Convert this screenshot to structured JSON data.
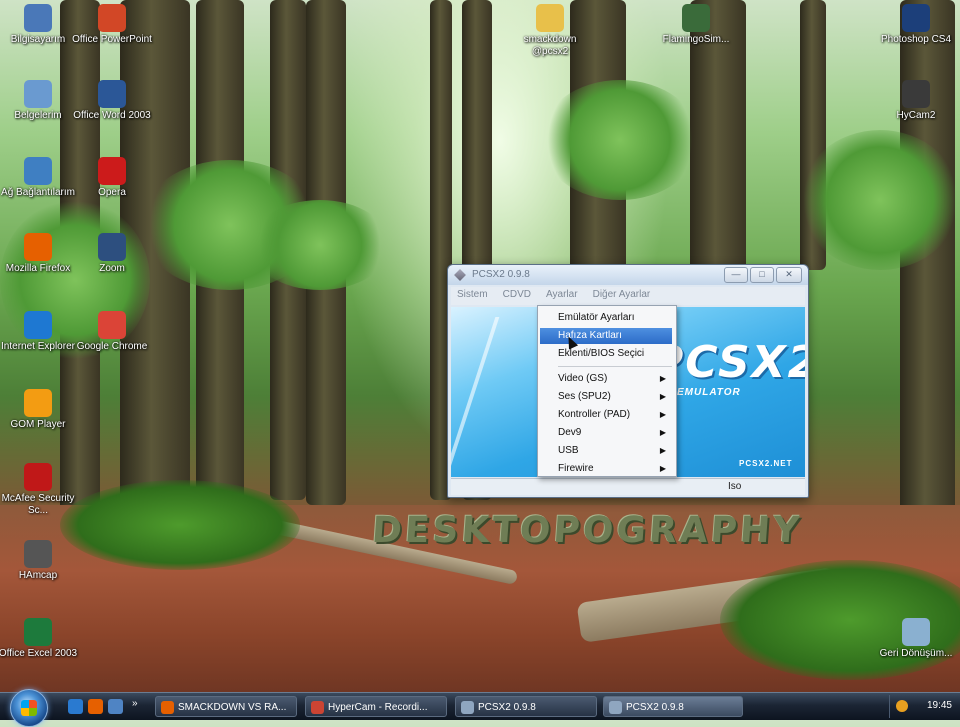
{
  "watermark": "DESKTOPOGRAPHY",
  "desktop_icons": [
    {
      "label": "Bilgisayarım",
      "icon": "computer-icon",
      "color": "#4a78b8"
    },
    {
      "label": "Office PowerPoint",
      "icon": "powerpoint-icon",
      "color": "#d24726"
    },
    {
      "label": "smackdown @pcsx2",
      "icon": "folder-icon",
      "color": "#e8c04a"
    },
    {
      "label": "FlamingoSim...",
      "icon": "game-icon",
      "color": "#3a6b3a"
    },
    {
      "label": "Photoshop CS4",
      "icon": "photoshop-icon",
      "color": "#1c3f7a"
    },
    {
      "label": "Belgelerim",
      "icon": "documents-icon",
      "color": "#6a9ad0"
    },
    {
      "label": "Office Word 2003",
      "icon": "word-icon",
      "color": "#2b5797"
    },
    {
      "label": "HyCam2",
      "icon": "camera-icon",
      "color": "#3a3a3a"
    },
    {
      "label": "Ağ Bağlantılarım",
      "icon": "network-icon",
      "color": "#3f7fc2"
    },
    {
      "label": "Opera",
      "icon": "opera-icon",
      "color": "#cc1b1b"
    },
    {
      "label": "Mozilla Firefox",
      "icon": "firefox-icon",
      "color": "#e66000"
    },
    {
      "label": "Zoom",
      "icon": "binoculars-icon",
      "color": "#2d4f7f"
    },
    {
      "label": "Internet Explorer",
      "icon": "ie-icon",
      "color": "#1e78d2"
    },
    {
      "label": "Google Chrome",
      "icon": "chrome-icon",
      "color": "#db4437"
    },
    {
      "label": "GOM Player",
      "icon": "gom-icon",
      "color": "#f39c12"
    },
    {
      "label": "McAfee Security Sc...",
      "icon": "mcafee-icon",
      "color": "#c01818"
    },
    {
      "label": "HAmcap",
      "icon": "hamcap-icon",
      "color": "#555555"
    },
    {
      "label": "Office Excel 2003",
      "icon": "excel-icon",
      "color": "#1d7a3c"
    },
    {
      "label": "Geri Dönüşüm...",
      "icon": "recycle-bin-icon",
      "color": "#8ab0d0"
    }
  ],
  "window": {
    "title": "PCSX2  0.9.8",
    "menu": [
      "Sistem",
      "CDVD",
      "Ayarlar",
      "Diğer Ayarlar"
    ],
    "logo_text": "PCSX2",
    "logo_sub": "EMULATOR",
    "site": "PCSX2.NET",
    "status": "Iso",
    "buttons": {
      "minimize": "—",
      "maximize": "□",
      "close": "✕"
    }
  },
  "dropdown": {
    "items": [
      {
        "label": "Emülatör Ayarları",
        "submenu": false,
        "highlighted": false
      },
      {
        "label": "Hafıza Kartları",
        "submenu": false,
        "highlighted": true
      },
      {
        "label": "Eklenti/BIOS Seçici",
        "submenu": false,
        "highlighted": false
      },
      {
        "label": "Video (GS)",
        "submenu": true,
        "highlighted": false
      },
      {
        "label": "Ses (SPU2)",
        "submenu": true,
        "highlighted": false
      },
      {
        "label": "Kontroller (PAD)",
        "submenu": true,
        "highlighted": false
      },
      {
        "label": "Dev9",
        "submenu": true,
        "highlighted": false
      },
      {
        "label": "USB",
        "submenu": true,
        "highlighted": false
      },
      {
        "label": "Firewire",
        "submenu": true,
        "highlighted": false
      }
    ],
    "submenu_arrow": "▶"
  },
  "taskbar": {
    "tasks": [
      {
        "label": "SMACKDOWN VS RA...",
        "icon": "firefox-icon",
        "color": "#e66000",
        "active": false
      },
      {
        "label": "HyperCam - Recordi...",
        "icon": "camera-icon",
        "color": "#c43",
        "active": false
      },
      {
        "label": "PCSX2  0.9.8",
        "icon": "pcsx2-icon",
        "color": "#8fa6c0",
        "active": false
      },
      {
        "label": "PCSX2  0.9.8",
        "icon": "pcsx2-icon",
        "color": "#8fa6c0",
        "active": true
      }
    ],
    "clock": "19:45"
  }
}
